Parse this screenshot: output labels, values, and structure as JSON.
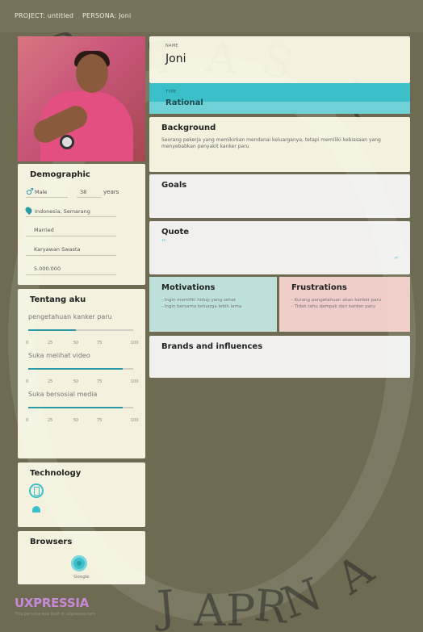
{
  "topbar": {
    "project": "PROJECT: untitled",
    "persona": "PERSONA: Joni"
  },
  "persona": {
    "name_label": "NAME",
    "name": "Joni",
    "type_label": "TYPE",
    "type": "Rational"
  },
  "demographic": {
    "title": "Demographic",
    "gender": "Male",
    "age": "38",
    "age_unit": "years",
    "location": "Indonesia, Semarang",
    "status": "Married",
    "occupation": "Karyawan Swasta",
    "income": "5.000.000"
  },
  "about": {
    "title": "Tentang aku",
    "sliders": [
      {
        "label": "pengetahuan kanker paru",
        "value": 45
      },
      {
        "label": "Suka melihat video",
        "value": 90
      },
      {
        "label": "Suka bersosial media",
        "value": 90
      }
    ],
    "ticks": [
      "0",
      "25",
      "50",
      "75",
      "100"
    ]
  },
  "technology": {
    "title": "Technology",
    "icons": [
      "phone-icon",
      "android-icon"
    ]
  },
  "browsers": {
    "title": "Browsers",
    "items": [
      {
        "label": "Google",
        "icon": "chrome-icon"
      }
    ]
  },
  "background": {
    "title": "Background",
    "text": "Seorang pekerja yang memikirkan mendanai keluarganya, tetapi memiliki kebiasaan yang menyebabkan penyakit kanker paru"
  },
  "goals": {
    "title": "Goals"
  },
  "quote": {
    "title": "Quote",
    "open_mark": "“",
    "close_mark": "”"
  },
  "motivations": {
    "title": "Motivations",
    "items": [
      "- Ingin memiliki hidup yang sehat",
      "- Ingin bersama keluarga lebih lama"
    ]
  },
  "frustrations": {
    "title": "Frustrations",
    "items": [
      "- Kurang pengetahuan akan kanker paru",
      "- Tidak tahu dampak dari kanker paru"
    ]
  },
  "brands": {
    "title": "Brands and influences"
  },
  "footer": {
    "brand": "UXPRESSIA",
    "note": "This persona was built in uxpressia.com"
  },
  "colors": {
    "accent": "#3bbfc9",
    "brand": "#c88ad7",
    "motivation_bg": "#c4ece8",
    "frustration_bg": "#fad6d2"
  }
}
